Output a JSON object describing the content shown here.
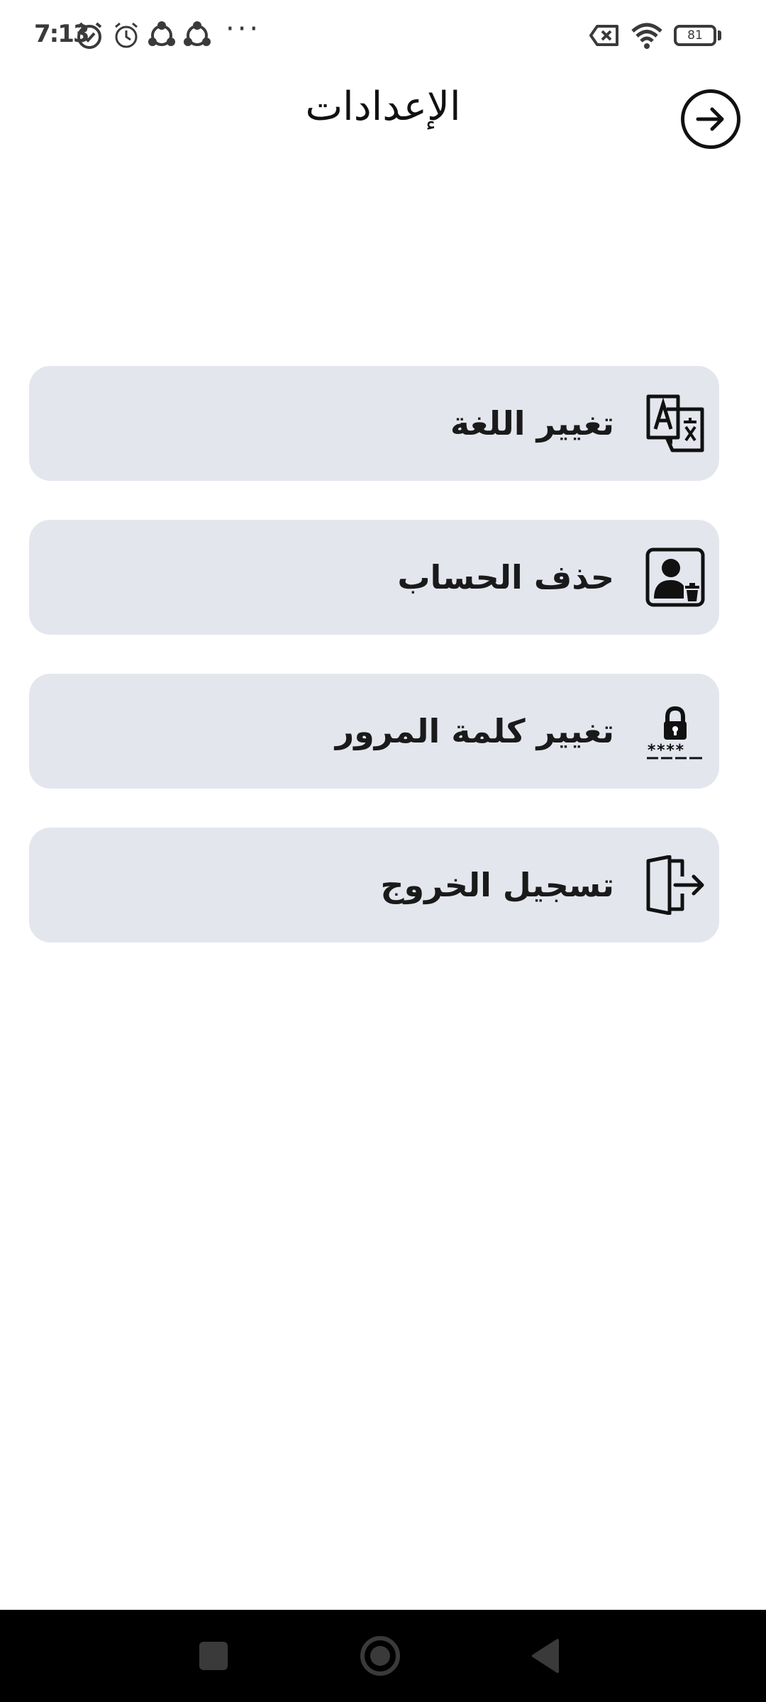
{
  "status_bar": {
    "time": "7:13",
    "battery": "81",
    "icons": [
      "alarm-check-icon",
      "alarm-icon",
      "share-icon",
      "share-icon",
      "more-icon",
      "no-sim-icon",
      "wifi-icon",
      "battery-icon"
    ]
  },
  "header": {
    "title": "الإعدادات",
    "back_icon": "arrow-right-circle-icon"
  },
  "settings": {
    "items": [
      {
        "label": "تغيير اللغة",
        "icon": "language-icon"
      },
      {
        "label": "حذف الحساب",
        "icon": "delete-account-icon"
      },
      {
        "label": "تغيير كلمة المرور",
        "icon": "password-lock-icon"
      },
      {
        "label": "تسجيل الخروج",
        "icon": "logout-icon"
      }
    ]
  },
  "nav_bar": {
    "buttons": [
      "recents-square-icon",
      "home-circle-icon",
      "back-triangle-icon"
    ]
  },
  "colors": {
    "item_background": "#e4e6ee",
    "text": "#1a1a1a",
    "nav_background": "#000000"
  }
}
